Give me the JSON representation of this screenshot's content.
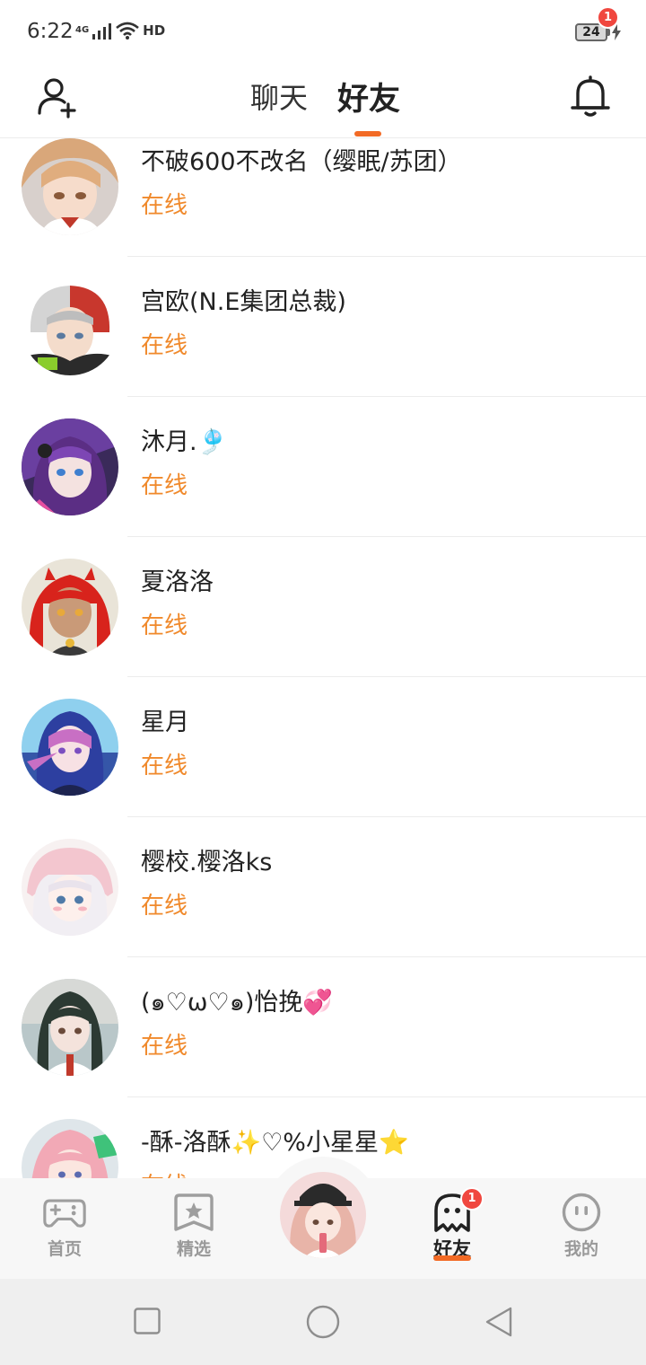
{
  "status_bar": {
    "time": "6:22",
    "network": "4G",
    "hd": "HD",
    "battery": "24"
  },
  "header": {
    "tabs": [
      {
        "label": "聊天",
        "active": false
      },
      {
        "label": "好友",
        "active": true
      }
    ],
    "notification_badge": "1",
    "accent_color": "#f26a25"
  },
  "friends": [
    {
      "name": "不破600不改名（缨眠/苏团）",
      "status": "在线",
      "avatar": "orange-hair-girl"
    },
    {
      "name": "宫欧(N.E集团总裁)",
      "status": "在线",
      "avatar": "white-red-hair-boy"
    },
    {
      "name": "沐月.🎐",
      "status": "在线",
      "avatar": "purple-hair-girl"
    },
    {
      "name": "夏洛洛",
      "status": "在线",
      "avatar": "red-twin-tail-girl"
    },
    {
      "name": "星月",
      "status": "在线",
      "avatar": "pink-hair-blue-hood-girl"
    },
    {
      "name": "樱校.樱洛ks",
      "status": "在线",
      "avatar": "white-hair-pink-hat-girl"
    },
    {
      "name": "(๑♡ω♡๑)怡挽💞",
      "status": "在线",
      "avatar": "dark-hair-kimono-girl"
    },
    {
      "name": "-酥-洛酥✨♡%小星星⭐",
      "status": "在线",
      "avatar": "pink-hair-green-headphones-girl"
    }
  ],
  "status_color": "#f0892b",
  "bottom_nav": {
    "items": [
      {
        "label": "首页",
        "icon": "gamepad-icon"
      },
      {
        "label": "精选",
        "icon": "star-bookmark-icon"
      },
      {
        "label": "好友",
        "icon": "ghost-icon",
        "active": true,
        "badge": "1"
      },
      {
        "label": "我的",
        "icon": "face-icon"
      }
    ]
  }
}
